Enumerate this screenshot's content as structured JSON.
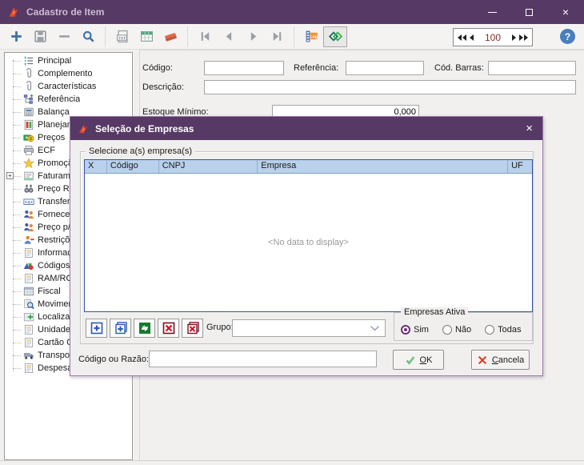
{
  "window": {
    "title": "Cadastro de Item",
    "controls": {
      "minimize": "minimize",
      "maximize": "maximize",
      "close": "×"
    }
  },
  "toolbar": {
    "groups": [
      [
        "add",
        "save",
        "delete",
        "search"
      ],
      [
        "txt-export",
        "grid-view",
        "clear"
      ],
      [
        "nav-first",
        "nav-prev",
        "nav-next",
        "nav-last"
      ],
      [
        "log",
        "company-select"
      ]
    ],
    "pressed": "company-select",
    "record_value": "100",
    "help_label": "?"
  },
  "sidebar": {
    "items": [
      {
        "label": "Principal",
        "icon": "list"
      },
      {
        "label": "Complemento",
        "icon": "paperclip"
      },
      {
        "label": "Características",
        "icon": "paperclip"
      },
      {
        "label": "Referência",
        "icon": "hierarchy"
      },
      {
        "label": "Balança",
        "icon": "calculator"
      },
      {
        "label": "Planejam",
        "icon": "planning"
      },
      {
        "label": "Preços",
        "icon": "money"
      },
      {
        "label": "ECF",
        "icon": "printer"
      },
      {
        "label": "Promoção",
        "icon": "star"
      },
      {
        "label": "Faturame",
        "icon": "invoice",
        "expander": true
      },
      {
        "label": "Preço Re",
        "icon": "binoculars"
      },
      {
        "label": "Transferê",
        "icon": "field"
      },
      {
        "label": "Forneced",
        "icon": "people"
      },
      {
        "label": "Preço p/",
        "icon": "people"
      },
      {
        "label": "Restriçõ",
        "icon": "person-minus"
      },
      {
        "label": "Informaç",
        "icon": "doc"
      },
      {
        "label": "Códigos",
        "icon": "shapes"
      },
      {
        "label": "RAM/RCM",
        "icon": "doc"
      },
      {
        "label": "Fiscal",
        "icon": "window"
      },
      {
        "label": "Moviment",
        "icon": "search-doc"
      },
      {
        "label": "Localizaç",
        "icon": "grid-plus"
      },
      {
        "label": "Unidade",
        "icon": "doc"
      },
      {
        "label": "Cartão C",
        "icon": "doc"
      },
      {
        "label": "Transpor",
        "icon": "truck"
      },
      {
        "label": "Despesa",
        "icon": "doc"
      }
    ]
  },
  "form": {
    "codigo_label": "Código:",
    "codigo_value": "",
    "referencia_label": "Referência:",
    "referencia_value": "",
    "cod_barras_label": "Cód. Barras:",
    "cod_barras_value": "",
    "descricao_label": "Descrição:",
    "descricao_value": "",
    "estoque_minimo_label": "Estoque Mínimo:",
    "estoque_minimo_value": "0,000"
  },
  "dialog": {
    "title": "Seleção de Empresas",
    "close": "×",
    "groupbox_label": "Selecione a(s) empresa(s)",
    "table": {
      "columns": [
        "X",
        "Código",
        "CNPJ",
        "Empresa",
        "UF"
      ],
      "rows": [],
      "empty_text": "<No data to display>"
    },
    "action_buttons": [
      "select-add",
      "select-add-all",
      "select-refresh",
      "select-remove",
      "select-remove-all"
    ],
    "grupo_label": "Grupo:",
    "grupo_value": "",
    "empresas_ativa": {
      "label": "Empresas Ativa",
      "options": [
        "Sim",
        "Não",
        "Todas"
      ],
      "selected": "Sim"
    },
    "codigo_razao_label": "Código ou Razão:",
    "codigo_razao_value": "",
    "ok_label": "OK",
    "cancel_label": "Cancela"
  },
  "colors": {
    "titlebar": "#573965",
    "grid_header": "#b9d1ea",
    "grid_border": "#3a53a3",
    "radio_selected": "#6a3077",
    "dialog_border": "#9b79af",
    "help_button": "#4a7ebd"
  }
}
